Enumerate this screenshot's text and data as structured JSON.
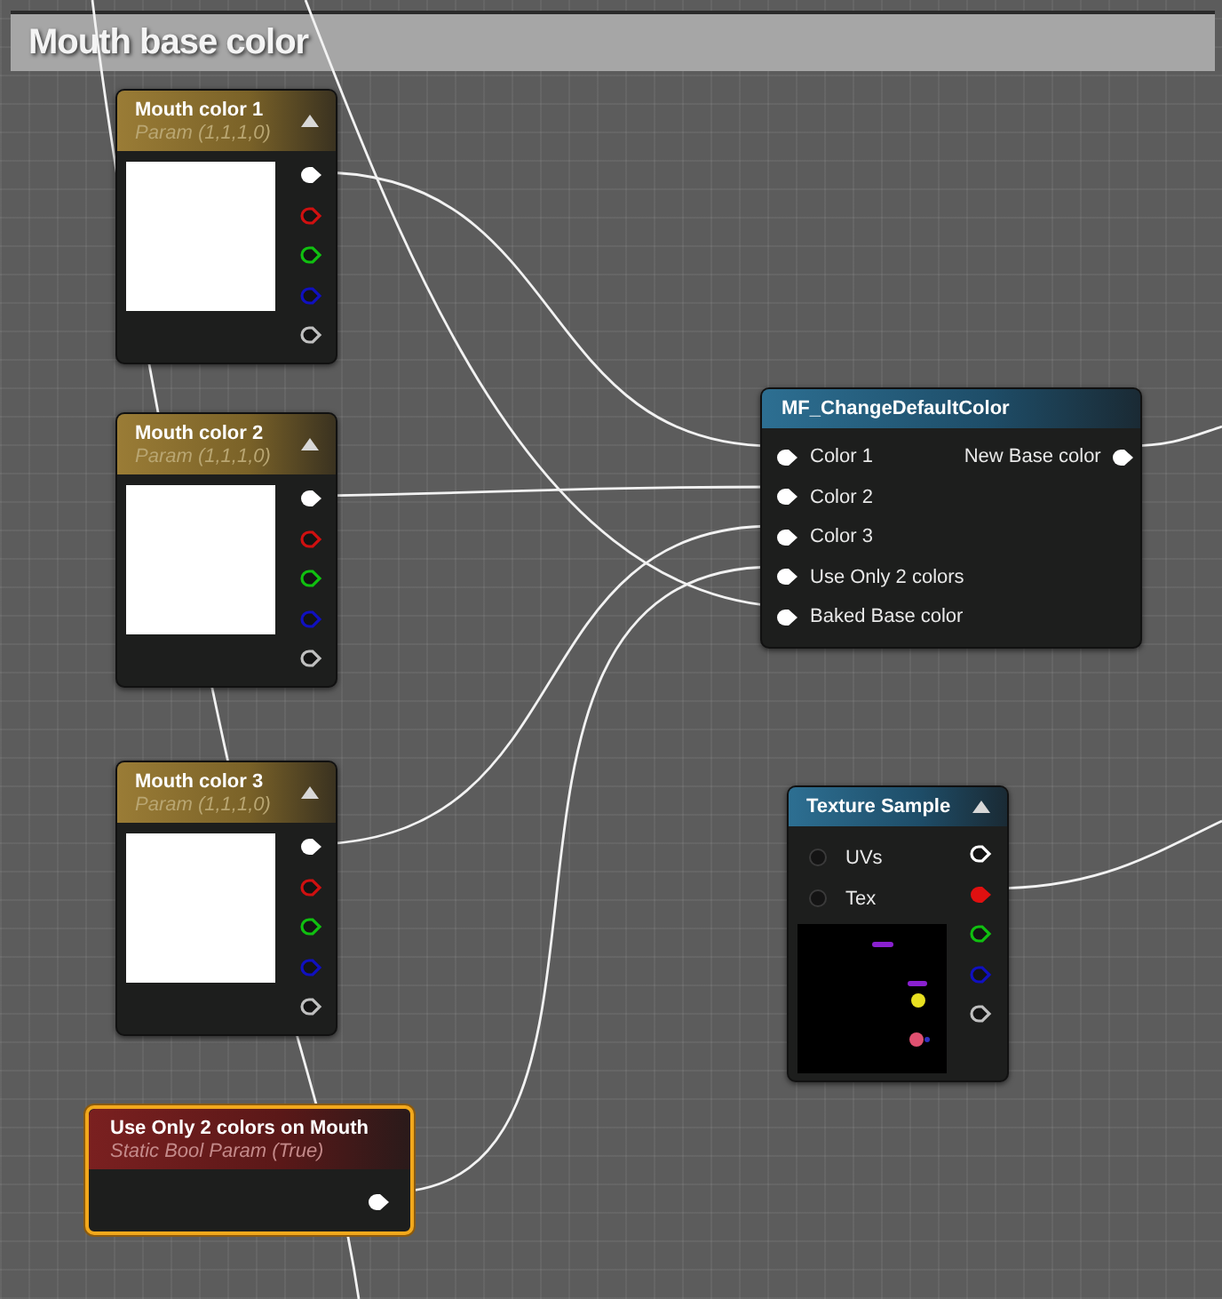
{
  "comment": {
    "title": "Mouth base color"
  },
  "nodes": [
    {
      "kind": "vector_param",
      "title": "Mouth color 1",
      "subtitle": "Param (1,1,1,0)",
      "selected": false,
      "outputs": [
        {
          "color": "#ffffff",
          "connected": true
        },
        {
          "color": "#d01010",
          "connected": false
        },
        {
          "color": "#10c010",
          "connected": false
        },
        {
          "color": "#1010c0",
          "connected": false
        },
        {
          "color": "#c0c0c0",
          "connected": false
        }
      ]
    },
    {
      "kind": "vector_param",
      "title": "Mouth color 2",
      "subtitle": "Param (1,1,1,0)",
      "selected": false,
      "outputs": [
        {
          "color": "#ffffff",
          "connected": true
        },
        {
          "color": "#d01010",
          "connected": false
        },
        {
          "color": "#10c010",
          "connected": false
        },
        {
          "color": "#1010c0",
          "connected": false
        },
        {
          "color": "#c0c0c0",
          "connected": false
        }
      ]
    },
    {
      "kind": "vector_param",
      "title": "Mouth color 3",
      "subtitle": "Param (1,1,1,0)",
      "selected": false,
      "outputs": [
        {
          "color": "#ffffff",
          "connected": true
        },
        {
          "color": "#d01010",
          "connected": false
        },
        {
          "color": "#10c010",
          "connected": false
        },
        {
          "color": "#1010c0",
          "connected": false
        },
        {
          "color": "#c0c0c0",
          "connected": false
        }
      ]
    },
    {
      "kind": "static_bool",
      "title": "Use Only 2 colors on Mouth",
      "subtitle": "Static Bool Param (True)",
      "selected": true,
      "outputs": [
        {
          "color": "#ffffff",
          "connected": true
        }
      ]
    },
    {
      "kind": "function",
      "title": "MF_ChangeDefaultColor",
      "selected": false,
      "inputs": [
        {
          "label": "Color 1",
          "connected": true
        },
        {
          "label": "Color 2",
          "connected": true
        },
        {
          "label": "Color 3",
          "connected": true
        },
        {
          "label": "Use Only 2 colors",
          "connected": true
        },
        {
          "label": "Baked Base color",
          "connected": true
        }
      ],
      "outputs": [
        {
          "label": "New Base color",
          "color": "#ffffff",
          "connected": true
        }
      ]
    },
    {
      "kind": "texture_sample",
      "title": "Texture Sample",
      "selected": false,
      "inputs": [
        {
          "label": "UVs",
          "connected": false
        },
        {
          "label": "Tex",
          "connected": false
        }
      ],
      "outputs": [
        {
          "color": "#ffffff",
          "connected": false
        },
        {
          "color": "#e01010",
          "connected": true
        },
        {
          "color": "#10c010",
          "connected": false
        },
        {
          "color": "#1010c0",
          "connected": false
        },
        {
          "color": "#c0c0c0",
          "connected": false
        }
      ]
    }
  ]
}
